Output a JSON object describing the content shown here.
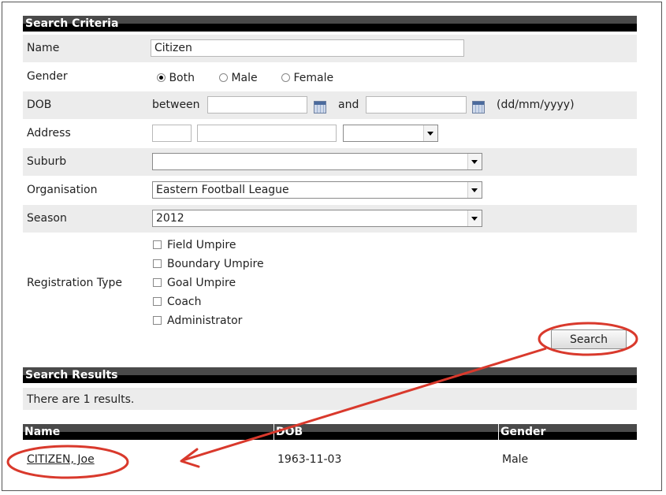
{
  "search_criteria": {
    "header": "Search Criteria",
    "name": {
      "label": "Name",
      "value": "Citizen"
    },
    "gender": {
      "label": "Gender",
      "options": [
        "Both",
        "Male",
        "Female"
      ],
      "selected": "Both"
    },
    "dob": {
      "label": "DOB",
      "between_label": "between",
      "and_label": "and",
      "from": "",
      "to": "",
      "format_hint": "(dd/mm/yyyy)"
    },
    "address": {
      "label": "Address",
      "number": "",
      "street": "",
      "street_type": ""
    },
    "suburb": {
      "label": "Suburb",
      "value": ""
    },
    "organisation": {
      "label": "Organisation",
      "value": "Eastern Football League"
    },
    "season": {
      "label": "Season",
      "value": "2012"
    },
    "registration_type": {
      "label": "Registration Type",
      "options": [
        "Field Umpire",
        "Boundary Umpire",
        "Goal Umpire",
        "Coach",
        "Administrator"
      ]
    },
    "search_button": "Search"
  },
  "search_results": {
    "header": "Search Results",
    "count_text": "There are 1 results.",
    "columns": [
      "Name",
      "DOB",
      "Gender"
    ],
    "rows": [
      {
        "name": "CITIZEN, Joe",
        "dob": "1963-11-03",
        "gender": "Male"
      }
    ]
  },
  "annotation": {
    "color": "#d9392c"
  },
  "icons": {
    "calendar": "calendar-icon",
    "dropdown": "chevron-down-icon"
  }
}
